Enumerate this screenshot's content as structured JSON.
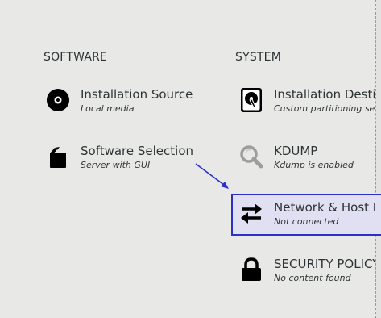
{
  "sections": {
    "software": "SOFTWARE",
    "system": "SYSTEM"
  },
  "software_spokes": [
    {
      "title": "Installation Source",
      "status": "Local media",
      "icon": "disc-icon"
    },
    {
      "title": "Software Selection",
      "status": "Server with GUI",
      "icon": "package-icon"
    }
  ],
  "system_spokes": [
    {
      "title": "Installation Destination",
      "status": "Custom partitioning selected",
      "icon": "hard-drive-icon"
    },
    {
      "title": "KDUMP",
      "status": "Kdump is enabled",
      "icon": "search-icon"
    },
    {
      "title": "Network & Host Name",
      "status": "Not connected",
      "icon": "network-arrows-icon"
    },
    {
      "title": "SECURITY POLICY",
      "status": "No content found",
      "icon": "lock-icon"
    }
  ],
  "colors": {
    "background": "#e8e8e7",
    "highlight_border": "#2d2fc9",
    "highlight_fill": "#e0e0f2",
    "annotation_arrow": "#2d2fc9"
  }
}
